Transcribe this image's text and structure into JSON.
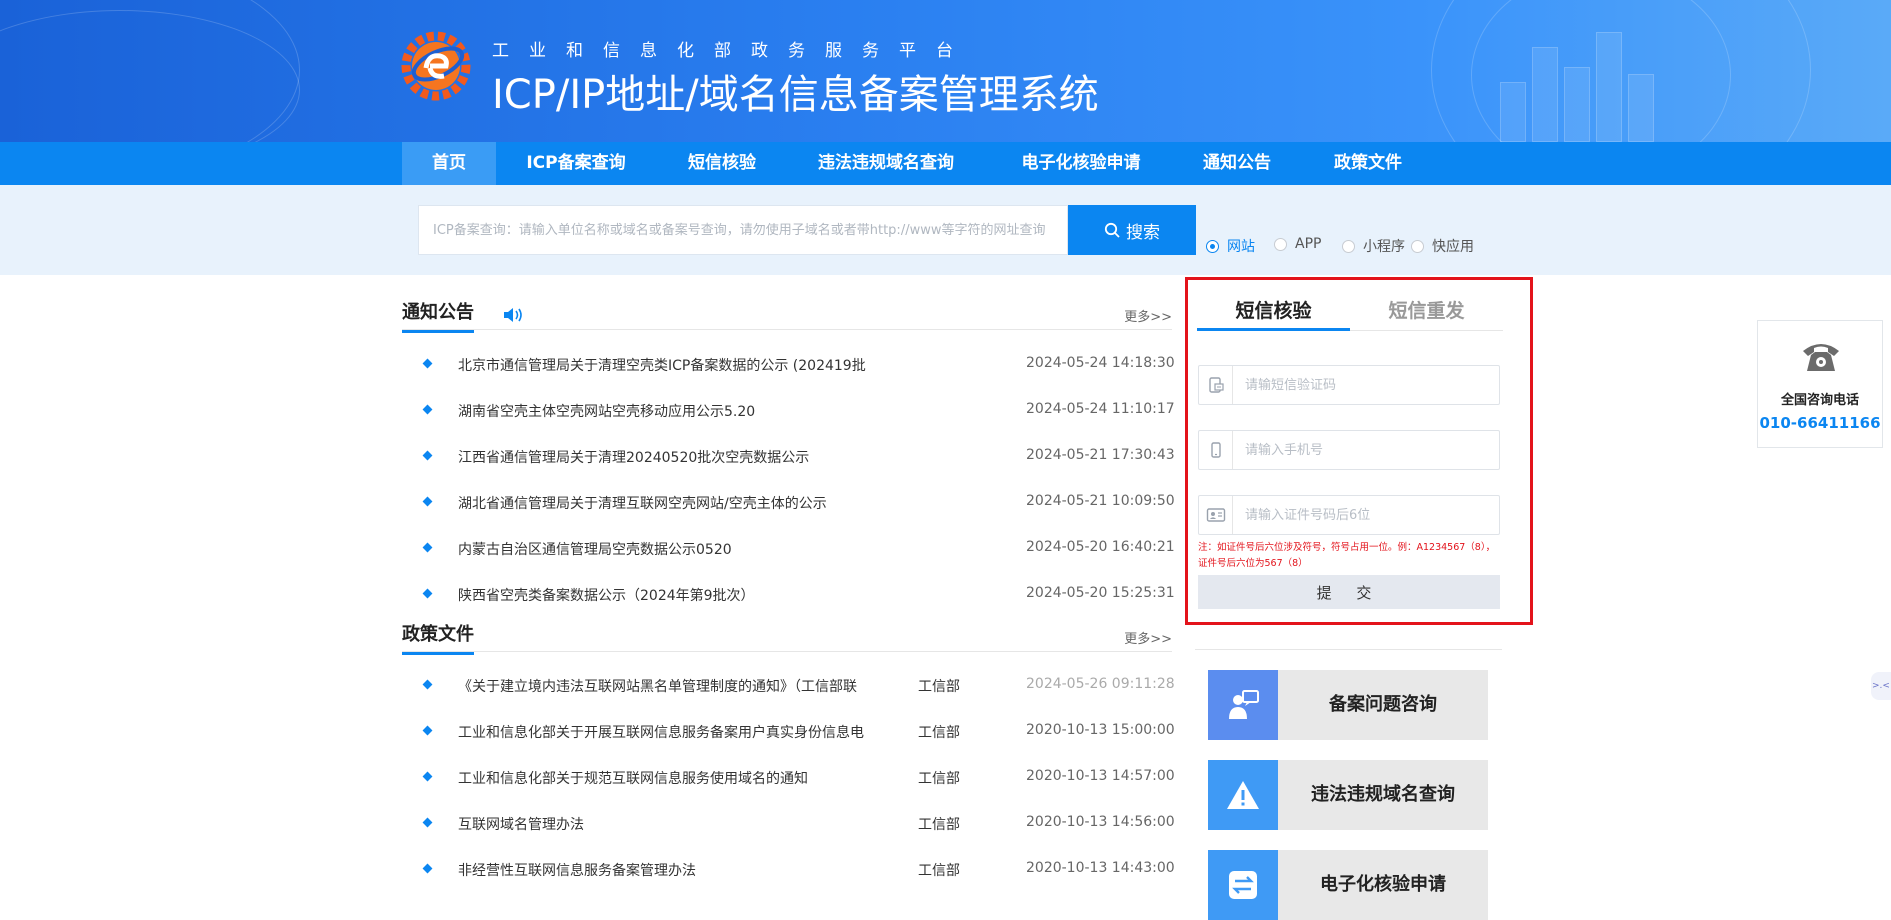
{
  "header": {
    "subtitle": "工业和信息化部政务服务平台",
    "title": "ICP/IP地址/域名信息备案管理系统"
  },
  "nav": [
    {
      "label": "首页",
      "active": true
    },
    {
      "label": "ICP备案查询"
    },
    {
      "label": "短信核验"
    },
    {
      "label": "违法违规域名查询"
    },
    {
      "label": "电子化核验申请"
    },
    {
      "label": "通知公告"
    },
    {
      "label": "政策文件"
    }
  ],
  "search": {
    "placeholder": "ICP备案查询：请输入单位名称或域名或备案号查询，请勿使用子域名或者带http://www等字符的网址查询",
    "button": "搜索",
    "options": [
      {
        "label": "网站",
        "checked": true
      },
      {
        "label": "APP"
      },
      {
        "label": "小程序"
      },
      {
        "label": "快应用"
      }
    ]
  },
  "notices": {
    "title": "通知公告",
    "more": "更多>>",
    "items": [
      {
        "title": "北京市通信管理局关于清理空壳类ICP备案数据的公示 (202419批",
        "date": "2024-05-24 14:18:30"
      },
      {
        "title": "湖南省空壳主体空壳网站空壳移动应用公示5.20",
        "date": "2024-05-24 11:10:17"
      },
      {
        "title": "江西省通信管理局关于清理20240520批次空壳数据公示",
        "date": "2024-05-21 17:30:43"
      },
      {
        "title": "湖北省通信管理局关于清理互联网空壳网站/空壳主体的公示",
        "date": "2024-05-21 10:09:50"
      },
      {
        "title": "内蒙古自治区通信管理局空壳数据公示0520",
        "date": "2024-05-20 16:40:21"
      },
      {
        "title": "陕西省空壳类备案数据公示（2024年第9批次）",
        "date": "2024-05-20 15:25:31"
      }
    ]
  },
  "policies": {
    "title": "政策文件",
    "more": "更多>>",
    "items": [
      {
        "title": "《关于建立境内违法互联网站黑名单管理制度的通知》（工信部联",
        "dept": "工信部",
        "date": "2024-05-26 09:11:28"
      },
      {
        "title": "工业和信息化部关于开展互联网信息服务备案用户真实身份信息电",
        "dept": "工信部",
        "date": "2020-10-13 15:00:00"
      },
      {
        "title": "工业和信息化部关于规范互联网信息服务使用域名的通知",
        "dept": "工信部",
        "date": "2020-10-13 14:57:00"
      },
      {
        "title": "互联网域名管理办法",
        "dept": "工信部",
        "date": "2020-10-13 14:56:00"
      },
      {
        "title": "非经营性互联网信息服务备案管理办法",
        "dept": "工信部",
        "date": "2020-10-13 14:43:00"
      }
    ]
  },
  "sms": {
    "tab_active": "短信核验",
    "tab_inactive": "短信重发",
    "code_placeholder": "请输短信验证码",
    "phone_placeholder": "请输入手机号",
    "id_placeholder": "请输入证件号码后6位",
    "note": "注：如证件号后六位涉及符号，符号占用一位。例：A1234567（8），证件号后六位为567（8）",
    "submit": "提 交",
    "highlight_color": "#e3131b"
  },
  "shortcuts": [
    {
      "label": "备案问题咨询",
      "icon": "consult-icon",
      "color": "#5b8def"
    },
    {
      "label": "违法违规域名查询",
      "icon": "warning-icon",
      "color": "#3f9af5"
    },
    {
      "label": "电子化核验申请",
      "icon": "exchange-icon",
      "color": "#3f9af5"
    }
  ],
  "hotline": {
    "label": "全国咨询电话",
    "number": "010-66411166",
    "icon": "phone-icon"
  },
  "edge_tab": ">.<",
  "colors": {
    "primary": "#0b86f1",
    "nav": "#0b86f1",
    "header": "#1a62d8"
  }
}
